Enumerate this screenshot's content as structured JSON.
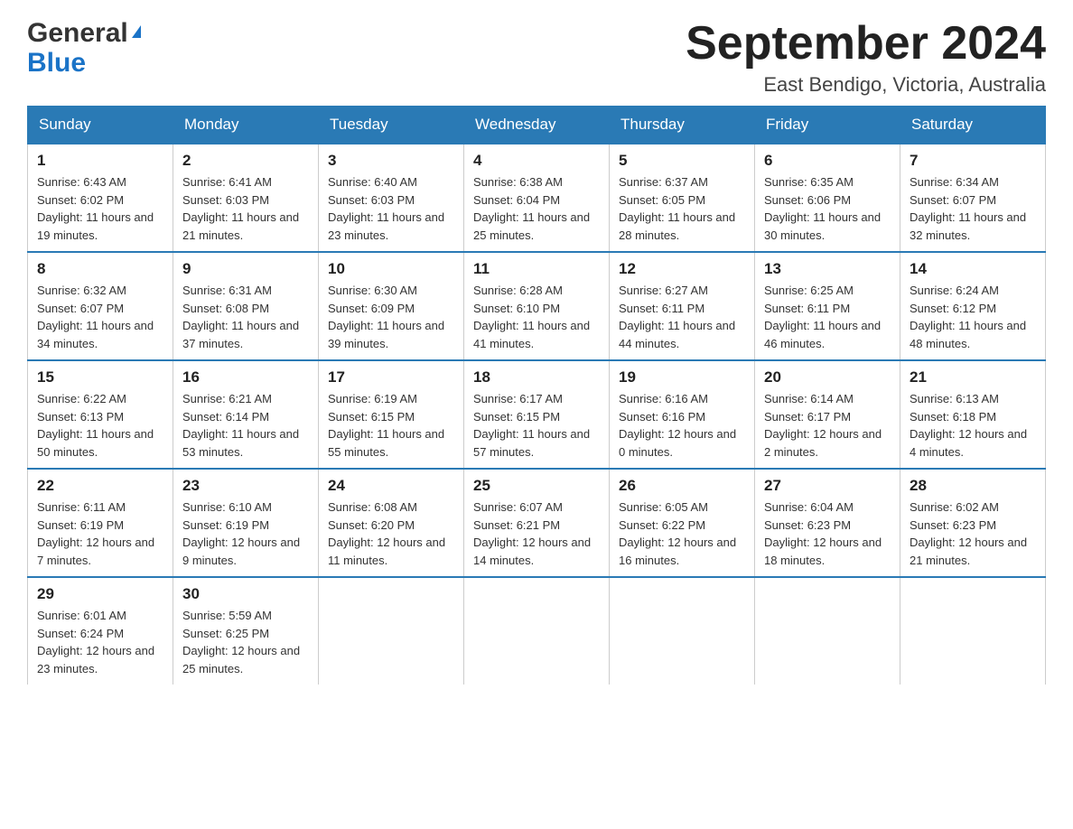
{
  "header": {
    "title": "September 2024",
    "subtitle": "East Bendigo, Victoria, Australia",
    "logo_general": "General",
    "logo_blue": "Blue"
  },
  "calendar": {
    "days_of_week": [
      "Sunday",
      "Monday",
      "Tuesday",
      "Wednesday",
      "Thursday",
      "Friday",
      "Saturday"
    ],
    "weeks": [
      [
        {
          "day": "1",
          "sunrise": "6:43 AM",
          "sunset": "6:02 PM",
          "daylight": "11 hours and 19 minutes."
        },
        {
          "day": "2",
          "sunrise": "6:41 AM",
          "sunset": "6:03 PM",
          "daylight": "11 hours and 21 minutes."
        },
        {
          "day": "3",
          "sunrise": "6:40 AM",
          "sunset": "6:03 PM",
          "daylight": "11 hours and 23 minutes."
        },
        {
          "day": "4",
          "sunrise": "6:38 AM",
          "sunset": "6:04 PM",
          "daylight": "11 hours and 25 minutes."
        },
        {
          "day": "5",
          "sunrise": "6:37 AM",
          "sunset": "6:05 PM",
          "daylight": "11 hours and 28 minutes."
        },
        {
          "day": "6",
          "sunrise": "6:35 AM",
          "sunset": "6:06 PM",
          "daylight": "11 hours and 30 minutes."
        },
        {
          "day": "7",
          "sunrise": "6:34 AM",
          "sunset": "6:07 PM",
          "daylight": "11 hours and 32 minutes."
        }
      ],
      [
        {
          "day": "8",
          "sunrise": "6:32 AM",
          "sunset": "6:07 PM",
          "daylight": "11 hours and 34 minutes."
        },
        {
          "day": "9",
          "sunrise": "6:31 AM",
          "sunset": "6:08 PM",
          "daylight": "11 hours and 37 minutes."
        },
        {
          "day": "10",
          "sunrise": "6:30 AM",
          "sunset": "6:09 PM",
          "daylight": "11 hours and 39 minutes."
        },
        {
          "day": "11",
          "sunrise": "6:28 AM",
          "sunset": "6:10 PM",
          "daylight": "11 hours and 41 minutes."
        },
        {
          "day": "12",
          "sunrise": "6:27 AM",
          "sunset": "6:11 PM",
          "daylight": "11 hours and 44 minutes."
        },
        {
          "day": "13",
          "sunrise": "6:25 AM",
          "sunset": "6:11 PM",
          "daylight": "11 hours and 46 minutes."
        },
        {
          "day": "14",
          "sunrise": "6:24 AM",
          "sunset": "6:12 PM",
          "daylight": "11 hours and 48 minutes."
        }
      ],
      [
        {
          "day": "15",
          "sunrise": "6:22 AM",
          "sunset": "6:13 PM",
          "daylight": "11 hours and 50 minutes."
        },
        {
          "day": "16",
          "sunrise": "6:21 AM",
          "sunset": "6:14 PM",
          "daylight": "11 hours and 53 minutes."
        },
        {
          "day": "17",
          "sunrise": "6:19 AM",
          "sunset": "6:15 PM",
          "daylight": "11 hours and 55 minutes."
        },
        {
          "day": "18",
          "sunrise": "6:17 AM",
          "sunset": "6:15 PM",
          "daylight": "11 hours and 57 minutes."
        },
        {
          "day": "19",
          "sunrise": "6:16 AM",
          "sunset": "6:16 PM",
          "daylight": "12 hours and 0 minutes."
        },
        {
          "day": "20",
          "sunrise": "6:14 AM",
          "sunset": "6:17 PM",
          "daylight": "12 hours and 2 minutes."
        },
        {
          "day": "21",
          "sunrise": "6:13 AM",
          "sunset": "6:18 PM",
          "daylight": "12 hours and 4 minutes."
        }
      ],
      [
        {
          "day": "22",
          "sunrise": "6:11 AM",
          "sunset": "6:19 PM",
          "daylight": "12 hours and 7 minutes."
        },
        {
          "day": "23",
          "sunrise": "6:10 AM",
          "sunset": "6:19 PM",
          "daylight": "12 hours and 9 minutes."
        },
        {
          "day": "24",
          "sunrise": "6:08 AM",
          "sunset": "6:20 PM",
          "daylight": "12 hours and 11 minutes."
        },
        {
          "day": "25",
          "sunrise": "6:07 AM",
          "sunset": "6:21 PM",
          "daylight": "12 hours and 14 minutes."
        },
        {
          "day": "26",
          "sunrise": "6:05 AM",
          "sunset": "6:22 PM",
          "daylight": "12 hours and 16 minutes."
        },
        {
          "day": "27",
          "sunrise": "6:04 AM",
          "sunset": "6:23 PM",
          "daylight": "12 hours and 18 minutes."
        },
        {
          "day": "28",
          "sunrise": "6:02 AM",
          "sunset": "6:23 PM",
          "daylight": "12 hours and 21 minutes."
        }
      ],
      [
        {
          "day": "29",
          "sunrise": "6:01 AM",
          "sunset": "6:24 PM",
          "daylight": "12 hours and 23 minutes."
        },
        {
          "day": "30",
          "sunrise": "5:59 AM",
          "sunset": "6:25 PM",
          "daylight": "12 hours and 25 minutes."
        },
        null,
        null,
        null,
        null,
        null
      ]
    ]
  }
}
